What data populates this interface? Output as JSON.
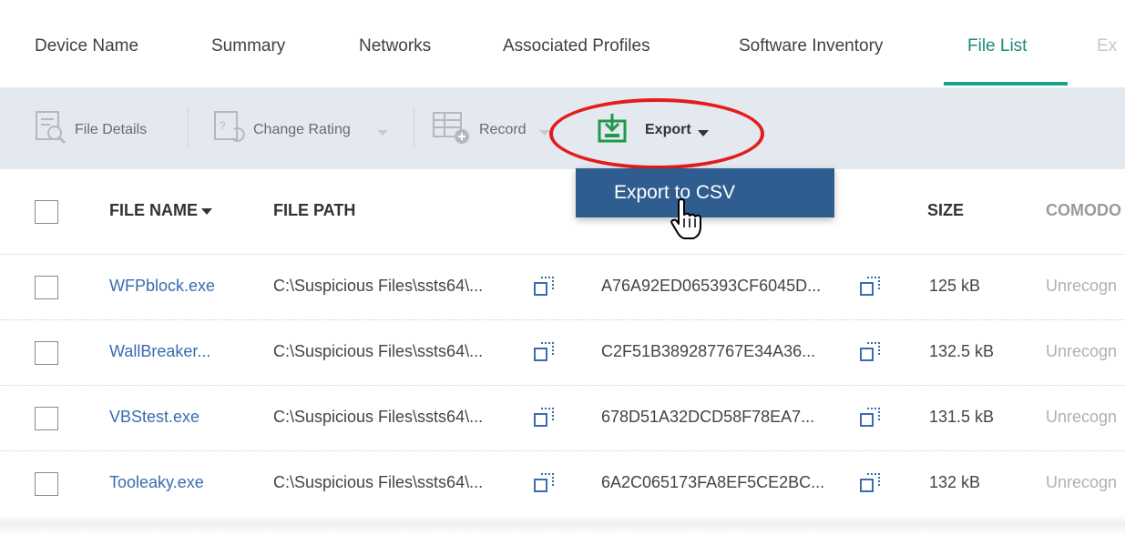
{
  "tabs": [
    {
      "label": "Device Name"
    },
    {
      "label": "Summary"
    },
    {
      "label": "Networks"
    },
    {
      "label": "Associated Profiles"
    },
    {
      "label": "Software Inventory"
    },
    {
      "label": "File List",
      "active": true
    },
    {
      "label": "Ex"
    }
  ],
  "toolbar": {
    "file_details": "File Details",
    "change_rating": "Change Rating",
    "record": "Record",
    "export": "Export"
  },
  "dropdown": {
    "export_to_csv": "Export to CSV"
  },
  "table": {
    "headers": {
      "file_name": "FILE NAME",
      "file_path": "FILE PATH",
      "size": "SIZE",
      "comodo": "COMODO"
    },
    "rows": [
      {
        "name": "WFPblock.exe",
        "path": "C:\\Suspicious Files\\ssts64\\...",
        "hash": "A76A92ED065393CF6045D...",
        "size": "125 kB",
        "rating": "Unrecogn"
      },
      {
        "name": "WallBreaker...",
        "path": "C:\\Suspicious Files\\ssts64\\...",
        "hash": "C2F51B389287767E34A36...",
        "size": "132.5 kB",
        "rating": "Unrecogn"
      },
      {
        "name": "VBStest.exe",
        "path": "C:\\Suspicious Files\\ssts64\\...",
        "hash": "678D51A32DCD58F78EA7...",
        "size": "131.5 kB",
        "rating": "Unrecogn"
      },
      {
        "name": "Tooleaky.exe",
        "path": "C:\\Suspicious Files\\ssts64\\...",
        "hash": "6A2C065173FA8EF5CE2BC...",
        "size": "132 kB",
        "rating": "Unrecogn"
      }
    ]
  },
  "colors": {
    "active_tab": "#1aa08d",
    "toolbar_bg": "#e4e8ef",
    "dropdown_bg": "#2f5d8f",
    "link": "#3b6bb0",
    "highlight": "#e11d1d"
  },
  "icons": [
    "file-details-icon",
    "change-rating-icon",
    "record-icon",
    "export-icon",
    "copy-icon",
    "hand-cursor-icon",
    "sort-caret-icon"
  ]
}
